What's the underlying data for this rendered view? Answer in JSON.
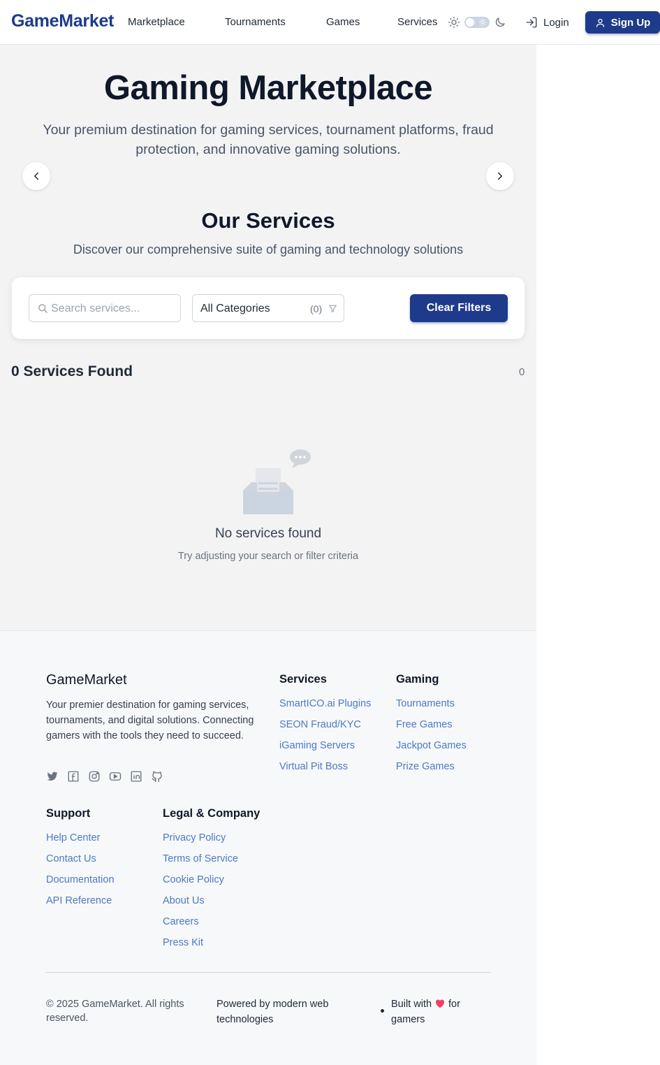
{
  "header": {
    "logo": "GameMarket",
    "nav": [
      "Marketplace",
      "Tournaments",
      "Games",
      "Services"
    ],
    "login_label": "Login",
    "signup_label": "Sign Up"
  },
  "hero": {
    "title": "Gaming Marketplace",
    "subtitle": "Your premium destination for gaming services, tournament platforms, fraud protection, and innovative gaming solutions."
  },
  "services": {
    "title": "Our Services",
    "subtitle": "Discover our comprehensive suite of gaming and technology solutions"
  },
  "filters": {
    "search_placeholder": "Search services...",
    "search_value": "",
    "category_value": "All Categories",
    "category_count": "(0)",
    "clear_label": "Clear Filters"
  },
  "results": {
    "title": "0 Services Found",
    "count": "0",
    "empty_title": "No services found",
    "empty_subtitle": "Try adjusting your search or filter criteria"
  },
  "footer": {
    "brand": "GameMarket",
    "description": "Your premier destination for gaming services, tournaments, and digital solutions. Connecting gamers with the tools they need to succeed.",
    "socials": [
      "twitter-icon",
      "facebook-icon",
      "instagram-icon",
      "youtube-icon",
      "linkedin-icon",
      "github-icon"
    ],
    "columns": {
      "services": {
        "title": "Services",
        "links": [
          "SmartICO.ai Plugins",
          "SEON Fraud/KYC",
          "iGaming Servers",
          "Virtual Pit Boss"
        ]
      },
      "gaming": {
        "title": "Gaming",
        "links": [
          "Tournaments",
          "Free Games",
          "Jackpot Games",
          "Prize Games"
        ]
      },
      "support": {
        "title": "Support",
        "links": [
          "Help Center",
          "Contact Us",
          "Documentation",
          "API Reference"
        ]
      },
      "legal": {
        "title": "Legal & Company",
        "links": [
          "Privacy Policy",
          "Terms of Service",
          "Cookie Policy",
          "About Us",
          "Careers",
          "Press Kit"
        ]
      }
    },
    "copyright": "© 2025 GameMarket. All rights reserved.",
    "powered": "Powered by modern web technologies",
    "built_pre": "Built with",
    "built_post": "for gamers"
  },
  "colors": {
    "brand": "#1e3a8a",
    "link": "#4a7ac7",
    "heart": "#f43f5e"
  }
}
